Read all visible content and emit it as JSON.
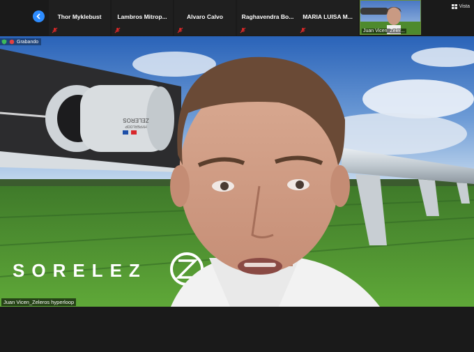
{
  "participants": [
    {
      "name": "Thor Myklebust"
    },
    {
      "name": "Lambros  Mitrop..."
    },
    {
      "name": "Alvaro Calvo"
    },
    {
      "name": "Raghavendra  Bo..."
    },
    {
      "name": "MARIA LUISA M..."
    }
  ],
  "self_view": {
    "name": "Juan Vicen_Zeler..."
  },
  "view_button": {
    "label": "Vista"
  },
  "recording": {
    "label": "Grabando"
  },
  "main_video": {
    "speaker": "Juan Vicen_Zeleros hyperloop",
    "logo_text": "SORELEZ",
    "pod_text_1": "ZELEROS",
    "pod_text_2": "HYPERLOOP"
  },
  "colors": {
    "accent": "#2d8cff",
    "mute": "#e02828",
    "background": "#1a1a1a"
  }
}
